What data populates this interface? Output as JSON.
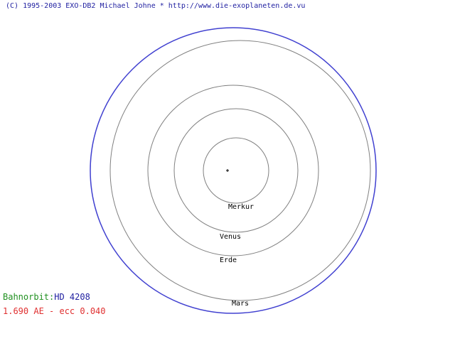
{
  "header": {
    "copyright": "(C) 1995-2003 EXO-DB2 Michael Johne * http://www.die-exoplaneten.de.vu"
  },
  "star": {
    "symbol": "+",
    "color": "#000000"
  },
  "orbits": [
    {
      "name": "Merkur",
      "color": "#808080"
    },
    {
      "name": "Venus",
      "color": "#808080"
    },
    {
      "name": "Erde",
      "color": "#808080"
    },
    {
      "name": "Mars",
      "color": "#808080"
    },
    {
      "name": "HD 4208",
      "color": "#4040d0"
    }
  ],
  "planet_labels": {
    "merkur": "Merkur",
    "venus": "Venus",
    "erde": "Erde",
    "mars": "Mars"
  },
  "info": {
    "label": "Bahnorbit:",
    "label_color": "#209020",
    "object_name": "HD 4208",
    "object_color": "#1e1ea0",
    "orbit_details": "1.690 AE - ecc 0.040",
    "details_color": "#e03030"
  }
}
